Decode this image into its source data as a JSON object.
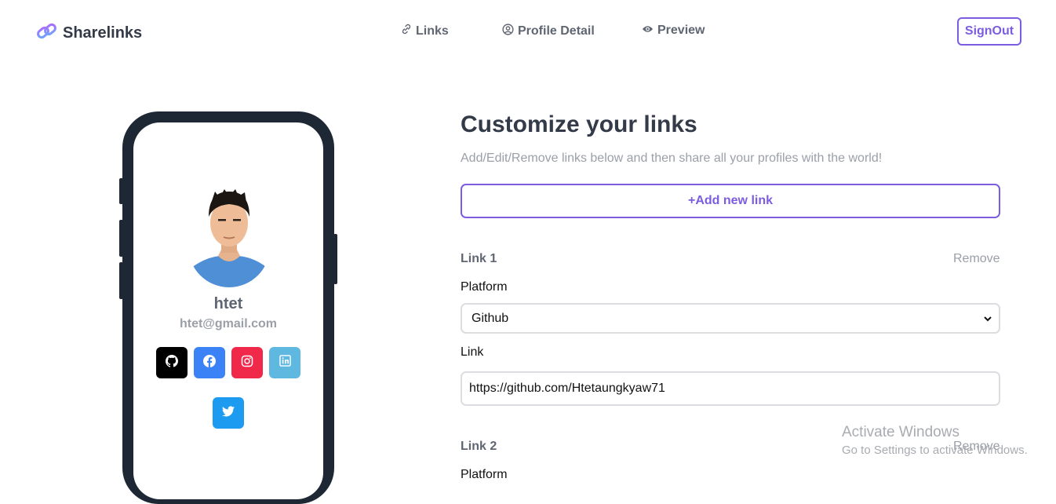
{
  "nav": {
    "brand": "Sharelinks",
    "links_label": "Links",
    "profile_label": "Profile Detail",
    "preview_label": "Preview",
    "signout_label": "SignOut"
  },
  "profile": {
    "name": "htet",
    "email": "htet@gmail.com",
    "socials": [
      {
        "icon": "github-icon",
        "color": "#000000"
      },
      {
        "icon": "facebook-icon",
        "color": "#3b82f6"
      },
      {
        "icon": "instagram-icon",
        "color": "#f0294a"
      },
      {
        "icon": "linkedin-icon",
        "color": "#5fb8e0"
      },
      {
        "icon": "twitter-icon",
        "color": "#1d9bf0"
      }
    ]
  },
  "main": {
    "title": "Customize your links",
    "subtitle": "Add/Edit/Remove links below and then share all your profiles with the world!",
    "add_button": "+Add new link",
    "links": [
      {
        "label": "Link 1",
        "remove": "Remove",
        "platform_label": "Platform",
        "platform_value": "Github",
        "link_label": "Link",
        "link_value": "https://github.com/Htetaungkyaw71"
      },
      {
        "label": "Link 2",
        "remove": "Remove",
        "platform_label": "Platform"
      }
    ]
  },
  "watermark": {
    "line1": "Activate Windows",
    "line2": "Go to Settings to activate Windows."
  },
  "colors": {
    "accent": "#7c5ce0",
    "phone_frame": "#1e2734"
  }
}
